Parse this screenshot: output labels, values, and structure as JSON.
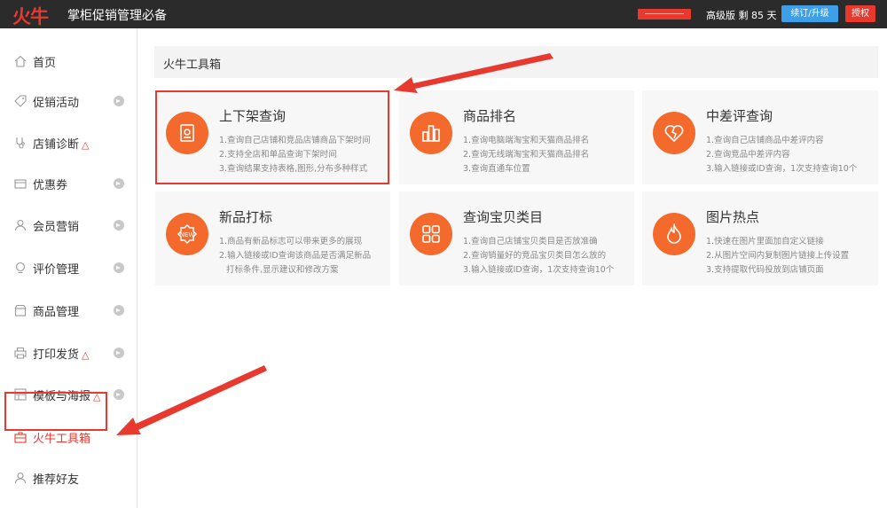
{
  "header": {
    "logo": "火牛",
    "app_title": "掌柜促销管理必备",
    "plan_text": "高级版 剩 85 天",
    "renew_button": "续订/升级",
    "auth_button": "授权"
  },
  "sidebar": {
    "items": [
      {
        "label": "首页"
      },
      {
        "label": "促销活动"
      },
      {
        "label": "店铺诊断"
      },
      {
        "label": "优惠券"
      },
      {
        "label": "会员营销"
      },
      {
        "label": "评价管理"
      },
      {
        "label": "商品管理"
      },
      {
        "label": "打印发货"
      },
      {
        "label": "模板与海报"
      },
      {
        "label": "火牛工具箱"
      },
      {
        "label": "推荐好友"
      }
    ]
  },
  "main": {
    "section_title": "火牛工具箱",
    "tools": [
      {
        "title": "上下架查询",
        "icon": "document-search-icon",
        "lines": [
          "1.查询自己店铺和竞品店铺商品下架时间",
          "2.支持全店和单品查询下架时间",
          "3.查询结果支持表格,图形,分布多种样式"
        ]
      },
      {
        "title": "商品排名",
        "icon": "ranking-bars-icon",
        "lines": [
          "1.查询电脑端淘宝和天猫商品排名",
          "2.查询无线端淘宝和天猫商品排名",
          "3.查询直通车位置"
        ]
      },
      {
        "title": "中差评查询",
        "icon": "broken-heart-icon",
        "lines": [
          "1.查询自己店铺商品中差评内容",
          "2.查询竞品中差评内容",
          "3.输入链接或ID查询，1次支持查询10个"
        ]
      },
      {
        "title": "新品打标",
        "icon": "new-tag-icon",
        "lines": [
          "1.商品有新品标志可以带来更多的展现",
          "2.输入链接或ID查询该商品是否满足新品",
          "打标条件,显示建议和修改方案"
        ]
      },
      {
        "title": "查询宝贝类目",
        "icon": "category-grid-icon",
        "lines": [
          "1.查询自己店铺宝贝类目是否放准确",
          "2.查询销量好的竞品宝贝类目怎么放的",
          "3.输入链接或ID查询，1次支持查询10个"
        ]
      },
      {
        "title": "图片热点",
        "icon": "flame-icon",
        "lines": [
          "1.快速在图片里面加自定义链接",
          "2.从图片空间内复制图片链接上传设置",
          "3.支持提取代码投放到店铺页面"
        ]
      }
    ]
  },
  "colors": {
    "accent": "#e8392f",
    "icon_orange": "#f36a2c",
    "renew_blue": "#3d9fe8",
    "topbar": "#2b2b2b"
  }
}
